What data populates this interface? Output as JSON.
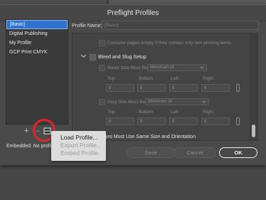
{
  "window": {
    "title": "Preflight Profiles"
  },
  "profiles": [
    "[Basic]",
    "Digital Publishing",
    "My Profile",
    "GCP Print CMYK"
  ],
  "list_toolbar": {
    "add_symbol": "+",
    "remove_symbol": "–"
  },
  "embedded_label": "Embedded: No profile",
  "profile_name": {
    "label": "Profile Name:",
    "value": "[Basic]"
  },
  "settings": {
    "consider_empty": "Consider pages empty if they contain only non-printing items",
    "bleed_slug_setup": "Bleed and Slug Setup",
    "bleed_size_label": "Bleed Size Must Be:",
    "bleed_select": "Minimum of",
    "slug_size_label": "Slug Size Must Be:",
    "slug_select": "Minimum of",
    "headers": {
      "top": "Top",
      "bottom": "Bottom",
      "left": "Left",
      "right": "Right"
    },
    "pages_same_size": "Pages Must Use Same Size and Orientation"
  },
  "context_menu": {
    "load": "Load Profile...",
    "export": "Export Profile...",
    "embed": "Embed Profile"
  },
  "buttons": {
    "save": "Save",
    "cancel": "Cancel",
    "ok": "OK"
  },
  "colors": {
    "selection": "#2f73cf",
    "highlight_circle": "#e0262b"
  }
}
